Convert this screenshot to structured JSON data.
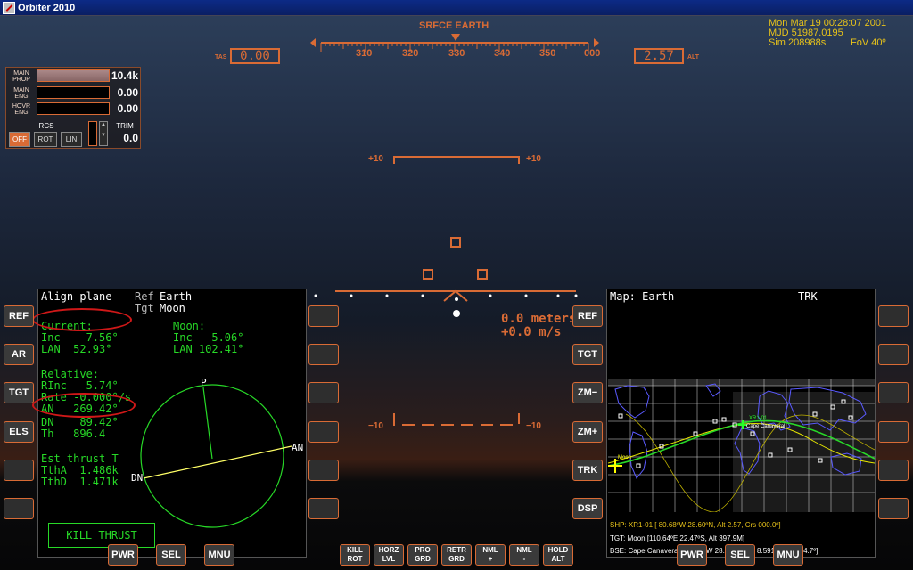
{
  "window": {
    "title": "Orbiter 2010"
  },
  "hud": {
    "mode": "SRFCE  EARTH",
    "heading_ticks": [
      "310",
      "320",
      "330",
      "340",
      "350",
      "000"
    ],
    "tas_label": "TAS",
    "tas_value": "0.00",
    "alt_label": "ALT",
    "alt_value": "2.57",
    "pitch_top_left": "+10",
    "pitch_top_right": "+10",
    "pitch_bot_left": "−10",
    "pitch_bot_right": "−10",
    "distance": "0.0 meters",
    "rate": "+0.0 m/s"
  },
  "sim": {
    "date": "Mon Mar 19 00:28:07 2001",
    "mjd": "MJD 51987.0195",
    "simtime": "Sim  208988s",
    "fov": "FoV  40º"
  },
  "engines": {
    "main_prop_label": "MAIN PROP",
    "main_prop_value": "10.4k",
    "main_eng_label": "MAIN ENG",
    "main_eng_value": "0.00",
    "hovr_eng_label": "HOVR ENG",
    "hovr_eng_value": "0.00",
    "rcs_label": "RCS",
    "rcs_off": "OFF",
    "rcs_rot": "ROT",
    "rcs_lin": "LIN",
    "trim_label": "TRIM",
    "trim_value": "0.0"
  },
  "left_mfd": {
    "title": "Align plane",
    "ref_label": "Ref",
    "ref_value": "Earth",
    "tgt_label": "Tgt",
    "tgt_value": "Moon",
    "current_header": "Current:",
    "cur_inc": "Inc    7.56°",
    "cur_lan": "LAN  52.93°",
    "moon_header": "Moon:",
    "moon_inc": "Inc   5.06°",
    "moon_lan": "LAN 102.41°",
    "relative_header": "Relative:",
    "rinc": "RInc   5.74°",
    "rate": "Rate -0.000°/s",
    "an": "AN   269.42°",
    "dn": "DN    89.42°",
    "th": "Th   896.4",
    "est_thrust": "Est thrust T",
    "ttha": "TthA  1.486k",
    "tthd": "TthD  1.471k",
    "kill_thrust": "KILL THRUST",
    "diagram_p": "P",
    "diagram_an": "AN",
    "diagram_dn": "DN",
    "buttons_left": [
      "REF",
      "AR",
      "TGT",
      "ELS",
      "",
      ""
    ],
    "buttons_bottom": [
      "PWR",
      "SEL",
      "MNU"
    ]
  },
  "right_mfd": {
    "title": "Map: Earth",
    "mode": "TRK",
    "buttons_left": [
      "REF",
      "TGT",
      "ZM−",
      "ZM+",
      "TRK",
      "DSP"
    ],
    "buttons_bottom": [
      "PWR",
      "SEL",
      "MNU"
    ],
    "shp_label": "SHP:",
    "shp_value": "XR1-01 [ 80.68ºW  28.60ºN, Alt 2.57, Crs 000.0º]",
    "tgt_label": "TGT:",
    "tgt_value": "Moon [110.64ºE  22.47ºS, Alt 397.9M]",
    "bse_label": "BSE:",
    "bse_value": "Cape Canaveral [ 80.67ºW  28.52ºN, Dst 8.591k, Brg 174.7º]",
    "map_ship_label": "XR1-01",
    "map_base_label": "Cape Canaveral",
    "map_moon_label": "Moon"
  },
  "nav_buttons": [
    {
      "l1": "KILL",
      "l2": "ROT"
    },
    {
      "l1": "HORZ",
      "l2": "LVL"
    },
    {
      "l1": "PRO",
      "l2": "GRD"
    },
    {
      "l1": "RETR",
      "l2": "GRD"
    },
    {
      "l1": "NML",
      "l2": "+"
    },
    {
      "l1": "NML",
      "l2": "-"
    },
    {
      "l1": "HOLD",
      "l2": "ALT"
    }
  ],
  "colors": {
    "hud": "#d96b35",
    "mfd_text": "#27d827",
    "sim_text": "#e8c31a",
    "highlight": "#d01818"
  }
}
